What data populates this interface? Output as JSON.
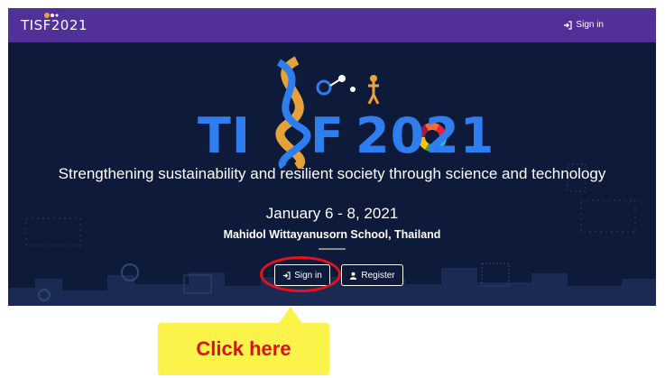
{
  "navbar": {
    "brand": "TISF2021",
    "signin_label": "Sign in"
  },
  "hero": {
    "logo_prefix": "TI",
    "logo_letter": "F",
    "logo_year": "2021",
    "tagline": "Strengthening sustainability and resilient society through science and technology",
    "dates": "January 6 - 8, 2021",
    "venue": "Mahidol Wittayanusorn School, Thailand",
    "signin_button": "Sign in",
    "register_button": "Register"
  },
  "callout": {
    "text": "Click here"
  },
  "colors": {
    "navbar": "#52309a",
    "hero": "#0e1a39",
    "logo": "#2f7ef0",
    "highlight": "#e8101c",
    "callout_bg": "#fbf34a",
    "callout_text": "#d9111a"
  }
}
